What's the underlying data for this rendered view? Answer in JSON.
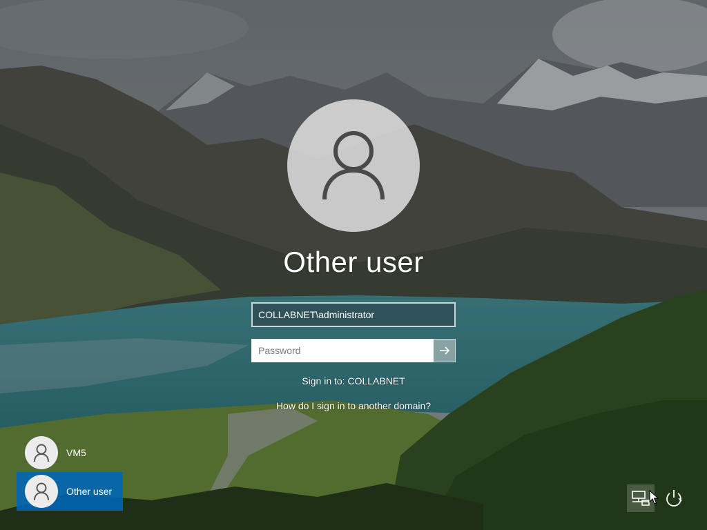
{
  "center": {
    "username": "Other user",
    "username_field_value": "COLLABNET\\administrator",
    "password_placeholder": "Password",
    "signin_to": "Sign in to: COLLABNET",
    "domain_help_link": "How do I sign in to another domain?"
  },
  "users": [
    {
      "name": "VM5",
      "selected": false
    },
    {
      "name": "Other user",
      "selected": true
    }
  ],
  "bottom_right": {
    "network_icon": "network-icon",
    "ease_of_access_icon": "ease-of-access-icon",
    "power_icon": "power-icon"
  },
  "colors": {
    "selected_tile": "#0067b8",
    "field_border": "#ffffff"
  }
}
